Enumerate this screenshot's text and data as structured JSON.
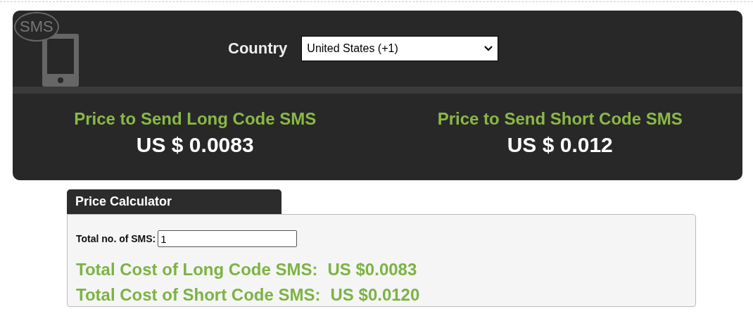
{
  "logo": {
    "text": "SMS"
  },
  "country": {
    "label": "Country",
    "value": "United States (+1)"
  },
  "prices": [
    {
      "title": "Price to Send Long Code SMS",
      "value": "US $ 0.0083"
    },
    {
      "title": "Price to Send Short Code SMS",
      "value": "US $ 0.012"
    }
  ],
  "calculator": {
    "tab": "Price Calculator",
    "field_label": "Total no. of SMS:",
    "field_value": "1",
    "results": [
      {
        "label": "Total Cost of Long Code SMS:",
        "value": "US $0.0083"
      },
      {
        "label": "Total Cost of Short Code SMS:",
        "value": "US $0.0120"
      }
    ]
  }
}
